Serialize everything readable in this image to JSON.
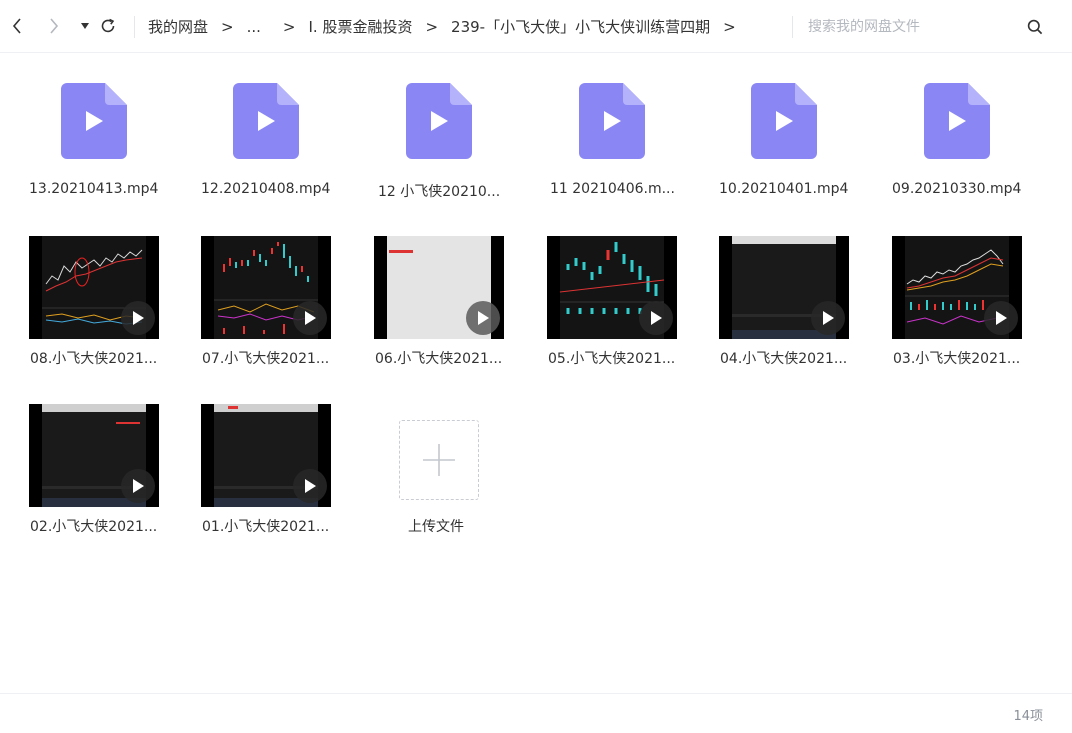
{
  "toolbar": {
    "back_icon": "chevron-left-icon",
    "forward_icon": "chevron-right-icon",
    "history_icon": "caret-down-icon",
    "refresh_icon": "refresh-icon",
    "search_icon": "search-icon"
  },
  "breadcrumb": {
    "items": [
      "我的网盘",
      "...",
      "I. 股票金融投资",
      "239-「小飞大侠」小飞大侠训练营四期"
    ],
    "separator": ">"
  },
  "search": {
    "placeholder": "搜索我的网盘文件",
    "value": ""
  },
  "files": [
    {
      "name": "13.20210413.mp4",
      "kind": "video-icon"
    },
    {
      "name": "12.20210408.mp4",
      "kind": "video-icon"
    },
    {
      "name": "12 小飞侠20210...",
      "kind": "video-icon"
    },
    {
      "name": "11 20210406.m...",
      "kind": "video-icon"
    },
    {
      "name": "10.20210401.mp4",
      "kind": "video-icon"
    },
    {
      "name": "09.20210330.mp4",
      "kind": "video-icon"
    },
    {
      "name": "08.小飞大侠2021...",
      "kind": "thumbnail"
    },
    {
      "name": "07.小飞大侠2021...",
      "kind": "thumbnail"
    },
    {
      "name": "06.小飞大侠2021...",
      "kind": "thumbnail"
    },
    {
      "name": "05.小飞大侠2021...",
      "kind": "thumbnail"
    },
    {
      "name": "04.小飞大侠2021...",
      "kind": "thumbnail"
    },
    {
      "name": "03.小飞大侠2021...",
      "kind": "thumbnail"
    },
    {
      "name": "02.小飞大侠2021...",
      "kind": "thumbnail"
    },
    {
      "name": "01.小飞大侠2021...",
      "kind": "thumbnail"
    }
  ],
  "upload": {
    "label": "上传文件",
    "icon": "plus-icon"
  },
  "footer": {
    "count": "14项"
  },
  "colors": {
    "video_icon": "#8a87f5",
    "accent": "#06a7ff"
  }
}
